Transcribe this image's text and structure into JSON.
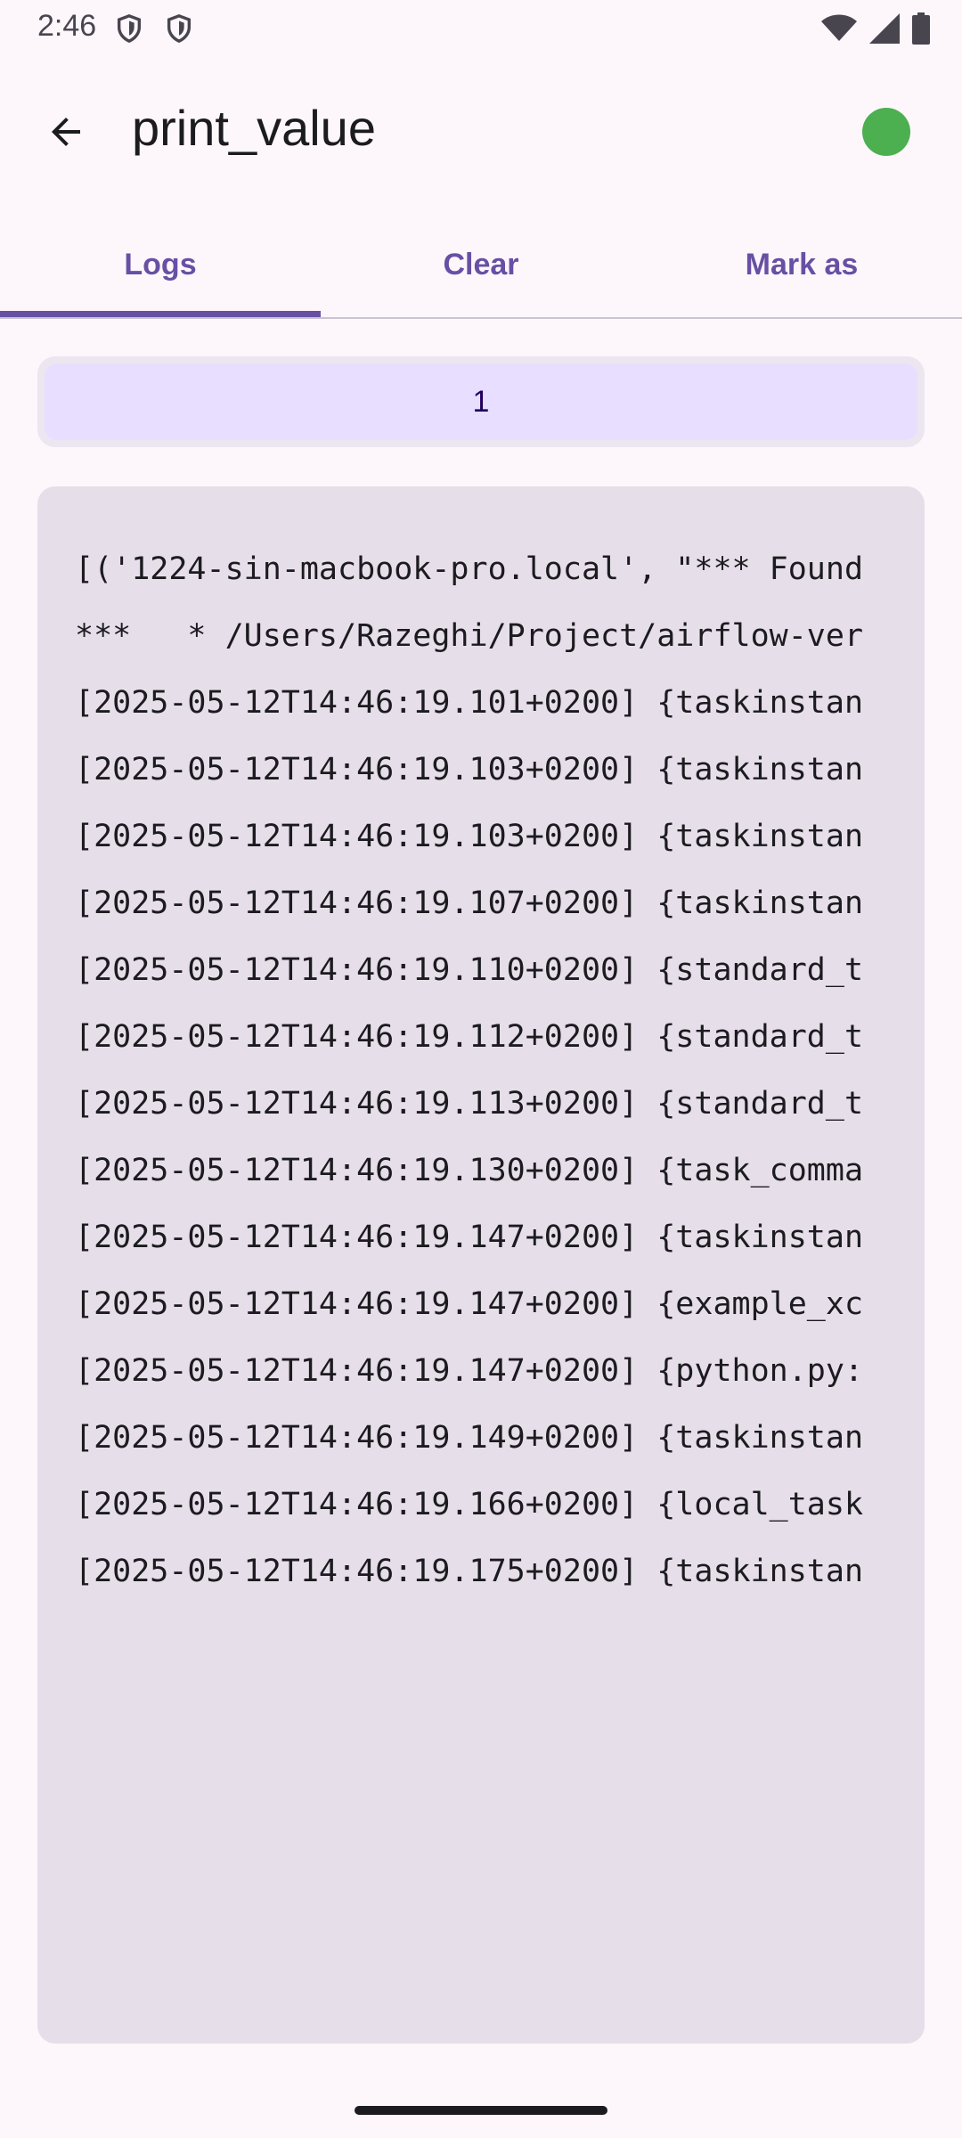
{
  "status_bar": {
    "time": "2:46",
    "icons": [
      "shield-icon",
      "shield-icon",
      "wifi-icon",
      "signal-icon",
      "battery-icon"
    ]
  },
  "app_bar": {
    "title": "print_value",
    "back_icon": "arrow-left-icon",
    "status_color": "#4caf50"
  },
  "tabs": [
    {
      "label": "Logs",
      "active": true
    },
    {
      "label": "Clear",
      "active": false
    },
    {
      "label": "Mark as",
      "active": false
    }
  ],
  "attempt": {
    "label": "1"
  },
  "log": {
    "lines": [
      "[('1224-sin-macbook-pro.local', \"*** Found",
      "***   * /Users/Razeghi/Project/airflow-ver",
      "[2025-05-12T14:46:19.101+0200] {taskinstan",
      "[2025-05-12T14:46:19.103+0200] {taskinstan",
      "[2025-05-12T14:46:19.103+0200] {taskinstan",
      "[2025-05-12T14:46:19.107+0200] {taskinstan",
      "[2025-05-12T14:46:19.110+0200] {standard_t",
      "[2025-05-12T14:46:19.112+0200] {standard_t",
      "[2025-05-12T14:46:19.113+0200] {standard_t",
      "[2025-05-12T14:46:19.130+0200] {task_comma",
      "[2025-05-12T14:46:19.147+0200] {taskinstan",
      "[2025-05-12T14:46:19.147+0200] {example_xc",
      "[2025-05-12T14:46:19.147+0200] {python.py:",
      "[2025-05-12T14:46:19.149+0200] {taskinstan",
      "[2025-05-12T14:46:19.166+0200] {local_task",
      "[2025-05-12T14:46:19.175+0200] {taskinstan"
    ]
  },
  "colors": {
    "accent": "#6750a4",
    "background": "#fdf7fc",
    "log_background": "#e6dfea",
    "attempt_background": "#e8deff"
  }
}
